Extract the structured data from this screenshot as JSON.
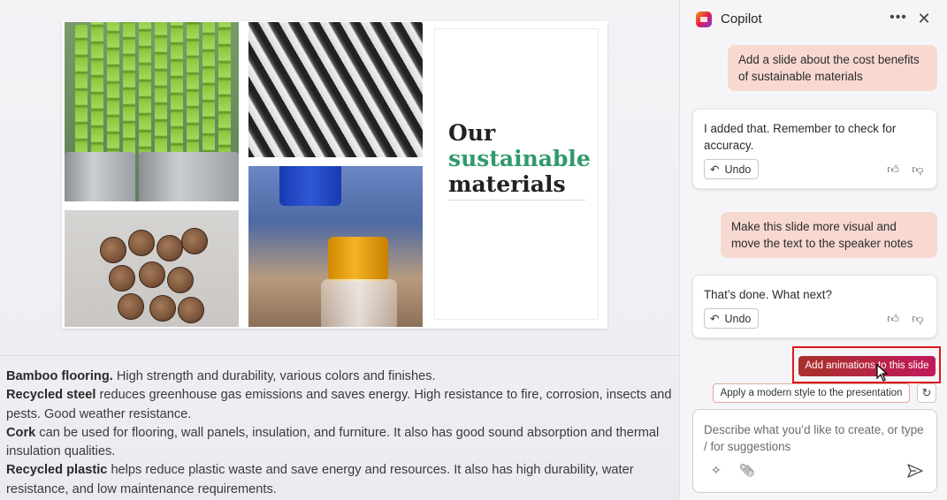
{
  "slide": {
    "title_line1": "Our",
    "title_line2": "sustainable",
    "title_line3": "materials",
    "accent_color": "#2f9a6a",
    "photos": [
      "bamboo",
      "steel",
      "cork",
      "plastic"
    ]
  },
  "notes": [
    {
      "bold": "Bamboo flooring.",
      "text": " High strength and durability, various colors and finishes."
    },
    {
      "bold": "Recycled steel",
      "text": " reduces greenhouse gas emissions and saves energy. High resistance to fire, corrosion, insects and pests. Good weather resistance."
    },
    {
      "bold": "Cork",
      "text": " can be used for flooring, wall panels, insulation, and furniture. It also has good sound absorption and thermal insulation qualities."
    },
    {
      "bold": "Recycled plastic",
      "text": " helps reduce plastic waste and save energy and resources. It also has high durability, water resistance, and low maintenance requirements."
    }
  ],
  "copilot": {
    "title": "Copilot",
    "more_icon": "more-icon",
    "close_icon": "close-icon",
    "messages": {
      "user1": "Add a slide about the cost benefits of sustainable materials",
      "bot1": "I added that. Remember to check for accuracy.",
      "user2": "Make this slide more visual and move the text to the speaker notes",
      "bot2": "That’s done. What next?"
    },
    "undo_label": "Undo",
    "suggestions": {
      "animations": "Add animations to this slide",
      "modern_style": "Apply a modern style to the presentation"
    },
    "composer_placeholder": "Describe what you’d like to create, or type / for suggestions",
    "brand_color": "#c2185b",
    "highlight_color": "#e0161b"
  }
}
